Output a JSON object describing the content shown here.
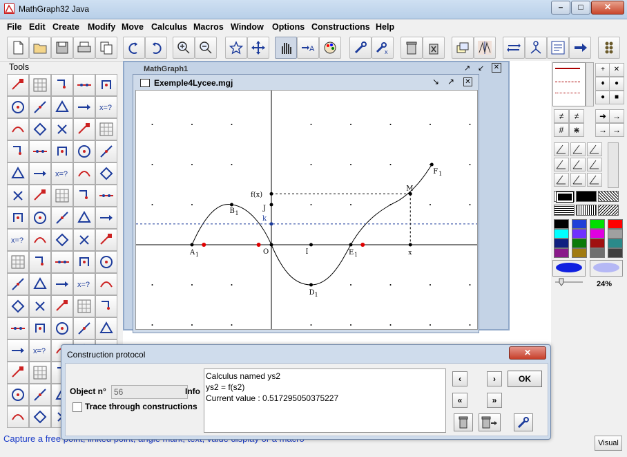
{
  "window": {
    "title": "MathGraph32 Java"
  },
  "menu": [
    "File",
    "Edit",
    "Create",
    "Modify",
    "Move",
    "Calculus",
    "Macros",
    "Window",
    "Options",
    "Constructions",
    "Help"
  ],
  "tools_label": "Tools",
  "outer_doc": {
    "title": "MathGraph1"
  },
  "doc": {
    "title": "Exemple4Lycee.mgj"
  },
  "figure": {
    "labels": {
      "A": "A",
      "A_sub": "1",
      "B": "B",
      "B_sub": "1",
      "D": "D",
      "D_sub": "1",
      "E": "E",
      "E_sub": "1",
      "F": "F",
      "F_sub": "1",
      "M": "M",
      "O": "O",
      "I": "I",
      "J": "J",
      "k": "k",
      "fx": "f(x)",
      "x": "x"
    }
  },
  "right_panel": {
    "zoom": "24%"
  },
  "status": "Capture a free point, linked point, angle mark, text, value display or a macro",
  "visual_button": "Visual",
  "dialog": {
    "title": "Construction protocol",
    "object_label": "Object n°",
    "object_value": "56",
    "info_label": "Info",
    "trace_label": "Trace through constructions",
    "info_lines": [
      "Calculus named ys2",
      "ys2 = f(s2)",
      "Current value :  0.517295050375227"
    ],
    "ok_label": "OK"
  },
  "colors": [
    "#000000",
    "#1f3fd8",
    "#00e000",
    "#ff0000",
    "#00ffff",
    "#7030ff",
    "#e000e0",
    "#a0a0a0",
    "#102080",
    "#0a7a0a",
    "#a01010",
    "#2a8a8a",
    "#8a1a8a",
    "#a07a10",
    "#707070",
    "#404040"
  ]
}
